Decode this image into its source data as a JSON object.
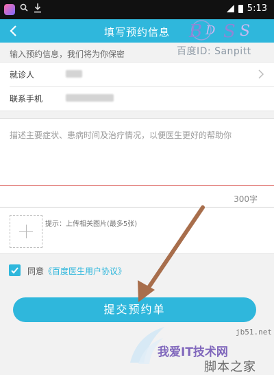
{
  "status_bar": {
    "time": "5:13",
    "left_icons": [
      "app-icon",
      "search-icon",
      "download-icon"
    ],
    "right_icons": [
      "signal-icon",
      "battery-icon"
    ]
  },
  "nav": {
    "title": "填写预约信息",
    "back_icon": "chevron-left-icon",
    "logo_text": "BDSS",
    "watermark": "百度ID: Sanpitt"
  },
  "form": {
    "hint": "输入预约信息，我们将为你保密",
    "patient_label": "就诊人",
    "phone_label": "联系手机",
    "description_placeholder": "描述主要症状、患病时间及治疗情况，以便医生更好的帮助你",
    "char_limit": "300字",
    "upload_hint": "提示：上传相关图片(最多5张)"
  },
  "agreement": {
    "checked": true,
    "text": "同意",
    "link": "《百度医生用户协议》"
  },
  "submit_label": "提交预约单",
  "site_watermark": {
    "site": "我爱IT技术网",
    "domain": "jb51.net",
    "jb": "脚本之家"
  },
  "colors": {
    "accent": "#2fb7dc",
    "status_bar": "#111111",
    "annotation_arrow": "#a86e4c",
    "divider_red": "#d9534f"
  }
}
